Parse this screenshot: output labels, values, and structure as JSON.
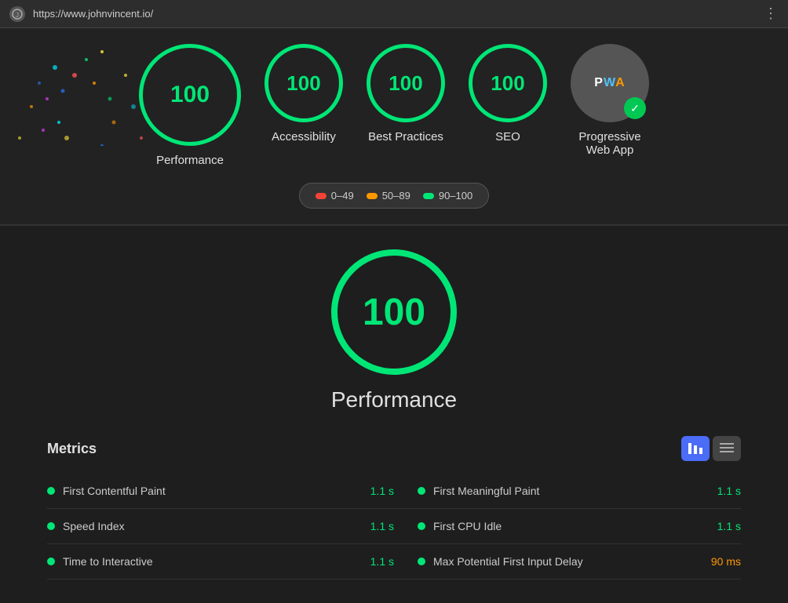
{
  "browser": {
    "url": "https://www.johnvincent.io/",
    "menu_icon": "⋮"
  },
  "scores": [
    {
      "id": "performance",
      "value": "100",
      "label": "Performance"
    },
    {
      "id": "accessibility",
      "value": "100",
      "label": "Accessibility"
    },
    {
      "id": "best-practices",
      "value": "100",
      "label": "Best Practices"
    },
    {
      "id": "seo",
      "value": "100",
      "label": "SEO"
    }
  ],
  "pwa": {
    "label": "Progressive\nWeb App",
    "text": "PWA",
    "check": "✓"
  },
  "legend": {
    "items": [
      {
        "id": "red",
        "range": "0–49",
        "color": "red"
      },
      {
        "id": "orange",
        "range": "50–89",
        "color": "orange"
      },
      {
        "id": "green",
        "range": "90–100",
        "color": "green"
      }
    ]
  },
  "main": {
    "score": "100",
    "title": "Performance",
    "metrics_label": "Metrics",
    "toggle_bar": "≡",
    "toggle_list": "☰",
    "metrics": [
      {
        "left": {
          "name": "First Contentful Paint",
          "value": "1.1 s",
          "color": "green"
        },
        "right": {
          "name": "First Meaningful Paint",
          "value": "1.1 s",
          "color": "green"
        }
      },
      {
        "left": {
          "name": "Speed Index",
          "value": "1.1 s",
          "color": "green"
        },
        "right": {
          "name": "First CPU Idle",
          "value": "1.1 s",
          "color": "green"
        }
      },
      {
        "left": {
          "name": "Time to Interactive",
          "value": "1.1 s",
          "color": "green"
        },
        "right": {
          "name": "Max Potential First Input Delay",
          "value": "90 ms",
          "color": "orange"
        }
      }
    ]
  }
}
